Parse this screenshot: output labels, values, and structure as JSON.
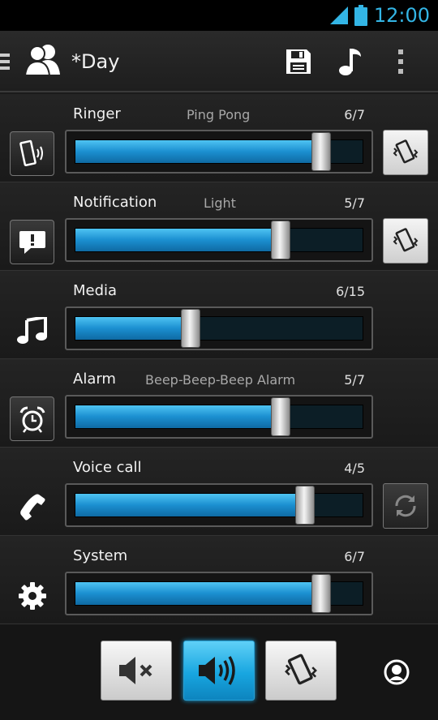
{
  "status_bar": {
    "time": "12:00"
  },
  "action_bar": {
    "title": "*Day",
    "menu_icon": "menu-icon",
    "profile_icon": "people-icon",
    "save_icon": "save-icon",
    "tone_icon": "music-note-icon",
    "overflow_icon": "overflow-menu-icon"
  },
  "rows": [
    {
      "label": "Ringer",
      "sub": "Ping Pong",
      "value_text": "6/7",
      "level": 6,
      "max": 7,
      "left_icon": "phone-ring-icon",
      "right_icon": "vibrate-icon"
    },
    {
      "label": "Notification",
      "sub": "Light",
      "value_text": "5/7",
      "level": 5,
      "max": 7,
      "left_icon": "notification-icon",
      "right_icon": "vibrate-icon"
    },
    {
      "label": "Media",
      "sub": "",
      "value_text": "6/15",
      "level": 6,
      "max": 15,
      "left_icon": "music-note-icon"
    },
    {
      "label": "Alarm",
      "sub": "Beep-Beep-Beep Alarm",
      "value_text": "5/7",
      "level": 5,
      "max": 7,
      "left_icon": "alarm-clock-icon"
    },
    {
      "label": "Voice call",
      "sub": "",
      "value_text": "4/5",
      "level": 4,
      "max": 5,
      "left_icon": "handset-icon",
      "right_icon": "sync-icon"
    },
    {
      "label": "System",
      "sub": "",
      "value_text": "6/7",
      "level": 6,
      "max": 7,
      "left_icon": "gear-icon"
    }
  ],
  "bottom_bar": {
    "modes": [
      "mute-icon",
      "sound-on-icon",
      "vibrate-icon"
    ],
    "active_mode": "sound-on-icon",
    "extra_icon": "circle-icon"
  },
  "colors": {
    "accent": "#33b5e5",
    "fill": "#1b8fd0"
  }
}
